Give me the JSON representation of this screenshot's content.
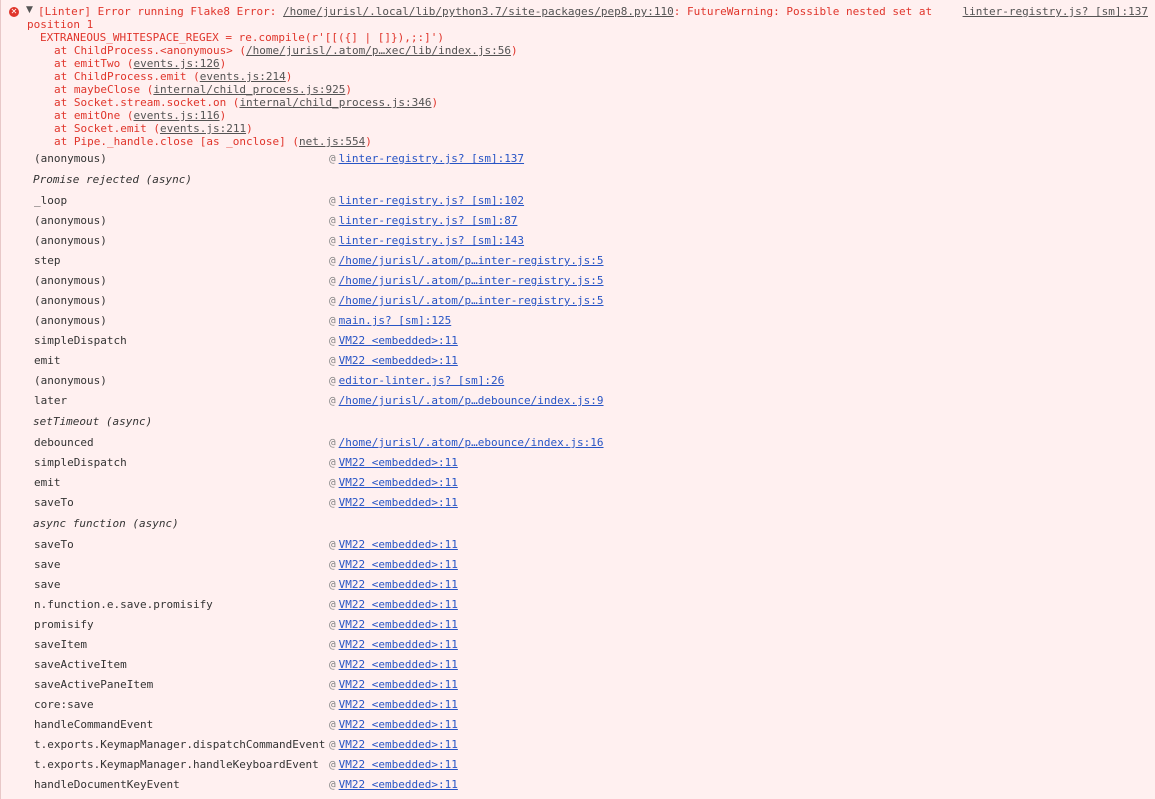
{
  "error": {
    "prefix": "[Linter] Error running Flake8 Error: ",
    "path_link": "/home/jurisl/.local/lib/python3.7/site-packages/pep8.py:110",
    "message": ": FutureWarning: Possible nested set at position 1",
    "source_link": "linter-registry.js? [sm]:137",
    "detail": "EXTRANEOUS_WHITESPACE_REGEX = re.compile(r'[[({] | []}),;:]')",
    "stack": [
      {
        "at": "at ChildProcess.<anonymous> (",
        "link": "/home/jurisl/.atom/p…xec/lib/index.js:56",
        "tail": ")"
      },
      {
        "at": "at emitTwo (",
        "link": "events.js:126",
        "tail": ")"
      },
      {
        "at": "at ChildProcess.emit (",
        "link": "events.js:214",
        "tail": ")"
      },
      {
        "at": "at maybeClose (",
        "link": "internal/child_process.js:925",
        "tail": ")"
      },
      {
        "at": "at Socket.stream.socket.on (",
        "link": "internal/child_process.js:346",
        "tail": ")"
      },
      {
        "at": "at emitOne (",
        "link": "events.js:116",
        "tail": ")"
      },
      {
        "at": "at Socket.emit (",
        "link": "events.js:211",
        "tail": ")"
      },
      {
        "at": "at Pipe._handle.close [as _onclose] (",
        "link": "net.js:554",
        "tail": ")"
      }
    ]
  },
  "at_sign": "@",
  "frames": [
    {
      "fn": "(anonymous)",
      "loc": "linter-registry.js? [sm]:137"
    },
    {
      "async": "Promise rejected (async)"
    },
    {
      "fn": "_loop",
      "loc": "linter-registry.js? [sm]:102"
    },
    {
      "fn": "(anonymous)",
      "loc": "linter-registry.js? [sm]:87"
    },
    {
      "fn": "(anonymous)",
      "loc": "linter-registry.js? [sm]:143"
    },
    {
      "fn": "step",
      "loc": "/home/jurisl/.atom/p…inter-registry.js:5"
    },
    {
      "fn": "(anonymous)",
      "loc": "/home/jurisl/.atom/p…inter-registry.js:5"
    },
    {
      "fn": "(anonymous)",
      "loc": "/home/jurisl/.atom/p…inter-registry.js:5"
    },
    {
      "fn": "(anonymous)",
      "loc": "main.js? [sm]:125"
    },
    {
      "fn": "simpleDispatch",
      "loc": "VM22 <embedded>:11"
    },
    {
      "fn": "emit",
      "loc": "VM22 <embedded>:11"
    },
    {
      "fn": "(anonymous)",
      "loc": "editor-linter.js? [sm]:26"
    },
    {
      "fn": "later",
      "loc": "/home/jurisl/.atom/p…debounce/index.js:9"
    },
    {
      "async": "setTimeout (async)"
    },
    {
      "fn": "debounced",
      "loc": "/home/jurisl/.atom/p…ebounce/index.js:16"
    },
    {
      "fn": "simpleDispatch",
      "loc": "VM22 <embedded>:11"
    },
    {
      "fn": "emit",
      "loc": "VM22 <embedded>:11"
    },
    {
      "fn": "saveTo",
      "loc": "VM22 <embedded>:11"
    },
    {
      "async": "async function (async)"
    },
    {
      "fn": "saveTo",
      "loc": "VM22 <embedded>:11"
    },
    {
      "fn": "save",
      "loc": "VM22 <embedded>:11"
    },
    {
      "fn": "save",
      "loc": "VM22 <embedded>:11"
    },
    {
      "fn": "n.function.e.save.promisify",
      "loc": "VM22 <embedded>:11"
    },
    {
      "fn": "promisify",
      "loc": "VM22 <embedded>:11"
    },
    {
      "fn": "saveItem",
      "loc": "VM22 <embedded>:11"
    },
    {
      "fn": "saveActiveItem",
      "loc": "VM22 <embedded>:11"
    },
    {
      "fn": "saveActivePaneItem",
      "loc": "VM22 <embedded>:11"
    },
    {
      "fn": "core:save",
      "loc": "VM22 <embedded>:11"
    },
    {
      "fn": "handleCommandEvent",
      "loc": "VM22 <embedded>:11"
    },
    {
      "fn": "t.exports.KeymapManager.dispatchCommandEvent",
      "loc": "VM22 <embedded>:11"
    },
    {
      "fn": "t.exports.KeymapManager.handleKeyboardEvent",
      "loc": "VM22 <embedded>:11"
    },
    {
      "fn": "handleDocumentKeyEvent",
      "loc": "VM22 <embedded>:11"
    }
  ]
}
